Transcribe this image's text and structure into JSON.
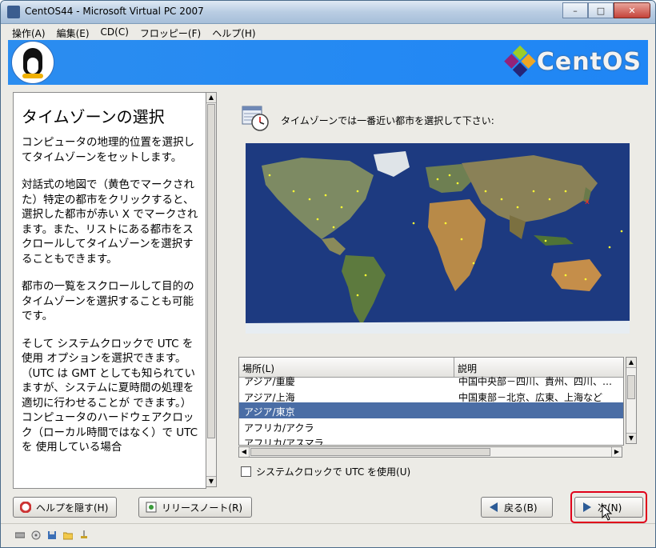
{
  "window": {
    "title": "CentOS44 - Microsoft Virtual PC 2007",
    "buttons": {
      "minimize": "–",
      "maximize": "□",
      "close": "✕"
    }
  },
  "menubar": {
    "items": [
      "操作(A)",
      "編集(E)",
      "CD(C)",
      "フロッピー(F)",
      "ヘルプ(H)"
    ]
  },
  "banner": {
    "logo_text": "CentOS"
  },
  "help": {
    "title": "タイムゾーンの選択",
    "paragraphs": [
      "コンピュータの地理的位置を選択してタイムゾーンをセットします。",
      "対話式の地図で（黄色でマークされた）特定の都市をクリックすると、選択した都市が赤い X でマークされます。また、リストにある都市をスクロールしてタイムゾーンを選択することもできます。",
      "都市の一覧をスクロールして目的のタイムゾーンを選択することも可能です。",
      "そして システムクロックで UTC を使用 オプションを選択できます。（UTC は GMT としても知られていますが、システムに夏時間の処理を適切に行わせることが できます。）コンピュータのハードウェアクロック（ローカル時間ではなく）で UTC を 使用している場合"
    ]
  },
  "prompt": {
    "text": "タイムゾーンでは一番近い都市を選択して下さい:"
  },
  "timezone_table": {
    "columns": [
      "場所(L)",
      "説明"
    ],
    "rows": [
      {
        "location": "アジア/重慶",
        "description": "中国中央部－四川、貴州、四川、…"
      },
      {
        "location": "アジア/上海",
        "description": "中国東部－北京、広東、上海など"
      },
      {
        "location": "アジア/東京",
        "description": ""
      },
      {
        "location": "アフリカ/アクラ",
        "description": ""
      },
      {
        "location": "アフリカ/アスマラ",
        "description": ""
      }
    ],
    "selected_index": 2
  },
  "utc_checkbox": {
    "label": "システムクロックで UTC を使用(U)",
    "checked": false
  },
  "buttons": {
    "hide_help": "ヘルプを隠す(H)",
    "release_notes": "リリースノート(R)",
    "back": "戻る(B)",
    "next": "次(N)"
  },
  "colors": {
    "banner": "#1f86f5",
    "selection": "#4a6da5",
    "highlight_outline": "#e0001a"
  }
}
